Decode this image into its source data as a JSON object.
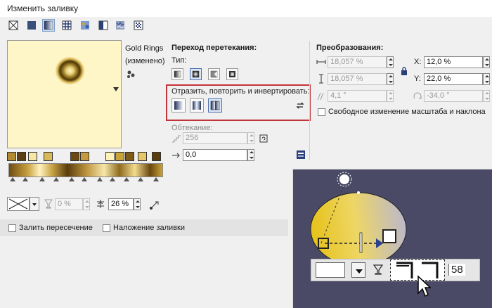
{
  "window": {
    "title": "Изменить заливку"
  },
  "toolbar": {
    "fill_types": [
      {
        "icon": "no-fill-icon"
      },
      {
        "icon": "uniform-fill-icon"
      },
      {
        "icon": "fountain-fill-icon",
        "selected": true
      },
      {
        "icon": "vector-pattern-icon"
      },
      {
        "icon": "bitmap-pattern-icon"
      },
      {
        "icon": "two-color-pattern-icon"
      },
      {
        "icon": "texture-fill-icon"
      },
      {
        "icon": "postscript-fill-icon"
      }
    ]
  },
  "preview": {
    "name": "Gold Rings",
    "status": "(изменено)"
  },
  "blend": {
    "title": "Переход перетекания:",
    "type_label": "Тип:",
    "mirror_label": "Отразить, повторить и инвертировать:",
    "wrap_label": "Обтекание:",
    "steps_value": "256",
    "accel_value": "0,0"
  },
  "transform": {
    "title": "Преобразования:",
    "width": "18,057 %",
    "height": "18,057 %",
    "skew": "4,1 °",
    "x_label": "X:",
    "x_value": "12,0 %",
    "y_label": "Y:",
    "y_value": "22,0 %",
    "rotate": "-34,0 °",
    "free_scale_label": "Свободное изменение масштаба и наклона"
  },
  "nodes": {
    "transparency": "0 %",
    "position": "26 %"
  },
  "bottom": {
    "fill_intersection": "Залить пересечение",
    "fill_overlap": "Наложение заливки"
  },
  "inset": {
    "value": "58"
  },
  "colors": {
    "accent_red": "#c3333b",
    "selection_blue": "#cfe0f5",
    "inset_bg": "#4b4a66",
    "gold": "#c9a23a"
  }
}
